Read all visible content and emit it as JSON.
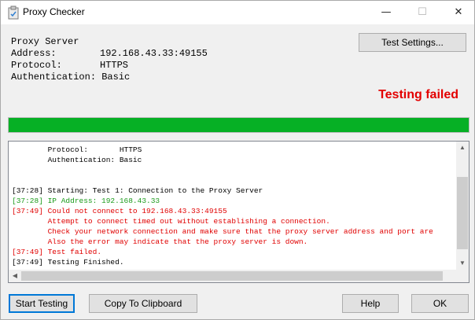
{
  "window": {
    "title": "Proxy Checker",
    "minimize_glyph": "—",
    "maximize_glyph": "☐",
    "close_glyph": "✕"
  },
  "info": {
    "heading": "Proxy Server",
    "address_label": "Address:",
    "address_value": "192.168.43.33:49155",
    "protocol_label": "Protocol:",
    "protocol_value": "HTTPS",
    "auth_label": "Authentication:",
    "auth_value": "Basic"
  },
  "buttons": {
    "test_settings": "Test Settings...",
    "start_testing": "Start Testing",
    "copy_clipboard": "Copy To Clipboard",
    "help": "Help",
    "ok": "OK"
  },
  "status": {
    "text": "Testing failed",
    "color": "#e30000"
  },
  "progress": {
    "percent": 100,
    "color": "#06b025"
  },
  "log": [
    {
      "text": "        Protocol:       HTTPS",
      "color": "black"
    },
    {
      "text": "        Authentication: Basic",
      "color": "black"
    },
    {
      "text": "",
      "color": "black"
    },
    {
      "text": "",
      "color": "black"
    },
    {
      "text": "[37:28] Starting: Test 1: Connection to the Proxy Server",
      "color": "black"
    },
    {
      "text": "[37:28] IP Address: 192.168.43.33",
      "color": "green"
    },
    {
      "text": "[37:49] Could not connect to 192.168.43.33:49155",
      "color": "red"
    },
    {
      "text": "        Attempt to connect timed out without establishing a connection.",
      "color": "red"
    },
    {
      "text": "        Check your network connection and make sure that the proxy server address and port are",
      "color": "red"
    },
    {
      "text": "        Also the error may indicate that the proxy server is down.",
      "color": "red"
    },
    {
      "text": "[37:49] Test failed.",
      "color": "red"
    },
    {
      "text": "[37:49] Testing Finished.",
      "color": "black"
    }
  ],
  "scrollbar": {
    "up_glyph": "▲",
    "down_glyph": "▼",
    "left_glyph": "◀",
    "right_glyph": "▶"
  }
}
